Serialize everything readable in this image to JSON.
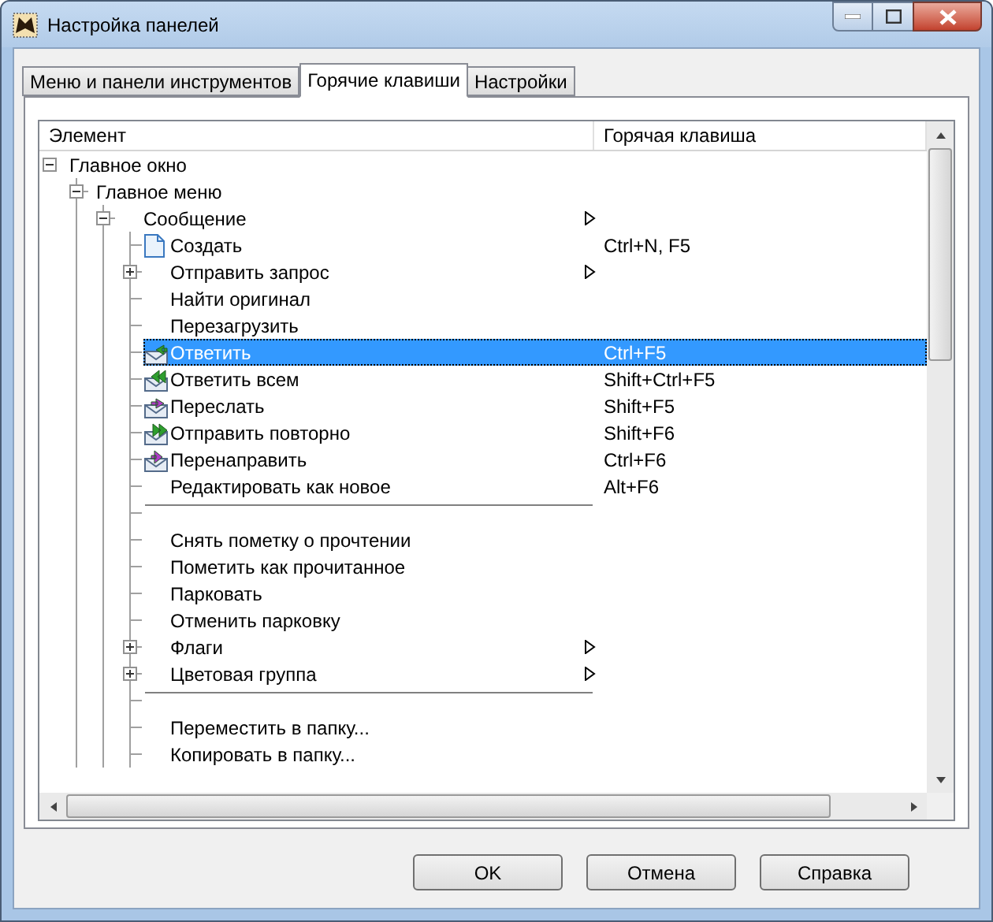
{
  "window": {
    "title": "Настройка панелей"
  },
  "tabs": [
    {
      "label": "Меню и панели инструментов",
      "selected": false
    },
    {
      "label": "Горячие клавиши",
      "selected": true
    },
    {
      "label": "Настройки",
      "selected": false
    }
  ],
  "tree": {
    "columns": [
      "Элемент",
      "Горячая клавиша"
    ],
    "items": [
      {
        "kind": "plain",
        "label": "Главное окно",
        "expanded": true,
        "selected": false,
        "children": [
          {
            "kind": "plain",
            "label": "Главное меню",
            "expanded": true,
            "selected": false,
            "children": [
              {
                "kind": "plain",
                "label": "Сообщение",
                "submenu": true,
                "expanded": true,
                "selected": false,
                "children": [
                  {
                    "kind": "document",
                    "label": "Создать",
                    "shortcut": "Ctrl+N, F5",
                    "selected": false
                  },
                  {
                    "kind": "plain",
                    "label": "Отправить запрос",
                    "submenu": true,
                    "expanded": false,
                    "selected": false
                  },
                  {
                    "kind": "plain",
                    "label": "Найти оригинал",
                    "selected": false
                  },
                  {
                    "kind": "plain",
                    "label": "Перезагрузить",
                    "selected": false
                  },
                  {
                    "kind": "reply",
                    "label": "Ответить",
                    "shortcut": "Ctrl+F5",
                    "selected": true
                  },
                  {
                    "kind": "replyall",
                    "label": "Ответить всем",
                    "shortcut": "Shift+Ctrl+F5",
                    "selected": false
                  },
                  {
                    "kind": "forward",
                    "label": "Переслать",
                    "shortcut": "Shift+F5",
                    "selected": false
                  },
                  {
                    "kind": "resend",
                    "label": "Отправить повторно",
                    "shortcut": "Shift+F6",
                    "selected": false
                  },
                  {
                    "kind": "redirect",
                    "label": "Перенаправить",
                    "shortcut": "Ctrl+F6",
                    "selected": false
                  },
                  {
                    "kind": "plain",
                    "label": "Редактировать как новое",
                    "shortcut": "Alt+F6",
                    "selected": false
                  },
                  {
                    "kind": "separator"
                  },
                  {
                    "kind": "plain",
                    "label": "Снять пометку о прочтении",
                    "selected": false
                  },
                  {
                    "kind": "plain",
                    "label": "Пометить как прочитанное",
                    "selected": false
                  },
                  {
                    "kind": "plain",
                    "label": "Парковать",
                    "selected": false
                  },
                  {
                    "kind": "plain",
                    "label": "Отменить парковку",
                    "selected": false
                  },
                  {
                    "kind": "plain",
                    "label": "Флаги",
                    "submenu": true,
                    "expanded": false,
                    "selected": false
                  },
                  {
                    "kind": "plain",
                    "label": "Цветовая группа",
                    "submenu": true,
                    "expanded": false,
                    "selected": false
                  },
                  {
                    "kind": "separator"
                  },
                  {
                    "kind": "plain",
                    "label": "Переместить в папку...",
                    "selected": false
                  },
                  {
                    "kind": "plain",
                    "label": "Копировать в папку...",
                    "selected": false
                  }
                ]
              }
            ]
          }
        ]
      }
    ]
  },
  "buttons": [
    "OK",
    "Отмена",
    "Справка"
  ]
}
